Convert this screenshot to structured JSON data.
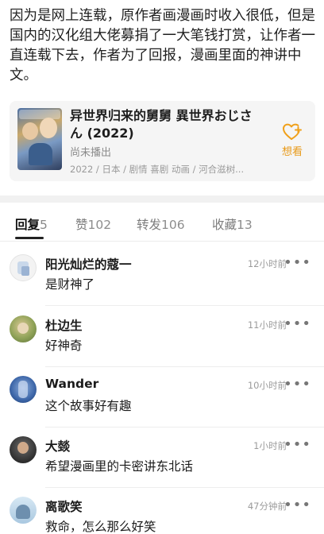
{
  "post": {
    "body": "因为是网上连载，原作者画漫画时收入很低，但是国内的汉化组大佬募捐了一大笔钱打赏，让作者一直连载下去，作者为了回报，漫画里面的神讲中文。"
  },
  "anime_card": {
    "title": "异世界归来的舅舅 異世界おじさん (2022)",
    "status": "尚未播出",
    "meta": "2022 / 日本 / 剧情 喜剧 动画 / 河合滋树...",
    "want_label": "想看",
    "want_icon": "heart-plus-icon",
    "accent_color": "#f0a019"
  },
  "tabs": [
    {
      "label": "回复",
      "count": "5",
      "active": true
    },
    {
      "label": "赞",
      "count": "102",
      "active": false
    },
    {
      "label": "转发",
      "count": "106",
      "active": false
    },
    {
      "label": "收藏",
      "count": "13",
      "active": false
    }
  ],
  "comments": [
    {
      "name": "阳光灿烂的蔻一",
      "text": "是财神了",
      "time": "12小时前",
      "more": "•••"
    },
    {
      "name": "杜边生",
      "text": "好神奇",
      "time": "11小时前",
      "more": "•••"
    },
    {
      "name": "Wander",
      "text": "这个故事好有趣",
      "time": "10小时前",
      "more": "•••"
    },
    {
      "name": "大燅",
      "text": "希望漫画里的卡密讲东北话",
      "time": "1小时前",
      "more": "•••"
    },
    {
      "name": "离歌笑",
      "text": "救命，怎么那么好笑",
      "time": "47分钟前",
      "more": "•••"
    }
  ]
}
